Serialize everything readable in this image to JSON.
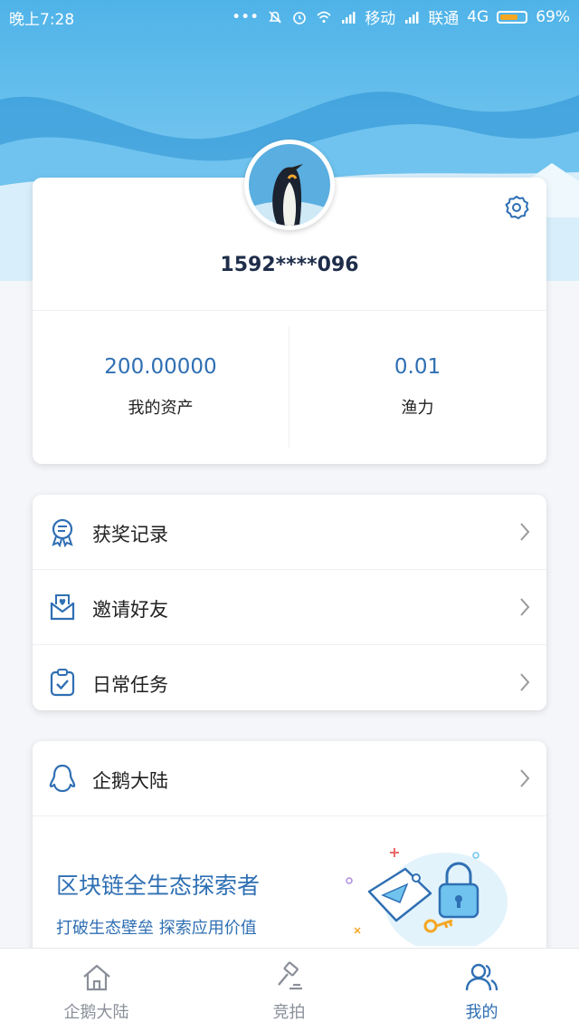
{
  "status_bar": {
    "time": "晚上7:28",
    "carrier1": "移动",
    "carrier2": "联通",
    "network": "4G",
    "battery": "69%"
  },
  "profile": {
    "phone": "1592****096",
    "stats": [
      {
        "value": "200.00000",
        "label": "我的资产"
      },
      {
        "value": "0.01",
        "label": "渔力"
      }
    ]
  },
  "menu": {
    "items": [
      {
        "label": "获奖记录",
        "icon": "award-icon"
      },
      {
        "label": "邀请好友",
        "icon": "invite-mail-icon"
      },
      {
        "label": "日常任务",
        "icon": "task-clipboard-icon"
      }
    ]
  },
  "qie": {
    "title": "企鹅大陆",
    "promo_title": "区块链全生态探索者",
    "promo_subtitle": "打破生态壁垒 探索应用价值"
  },
  "tabs": [
    {
      "label": "企鹅大陆",
      "icon": "home-icon",
      "active": false
    },
    {
      "label": "竞拍",
      "icon": "auction-hammer-icon",
      "active": false
    },
    {
      "label": "我的",
      "icon": "user-profile-icon",
      "active": true
    }
  ],
  "colors": {
    "accent": "#2f6fb3",
    "text_dark": "#1e2d4a",
    "sky_top": "#4fb3e8"
  }
}
